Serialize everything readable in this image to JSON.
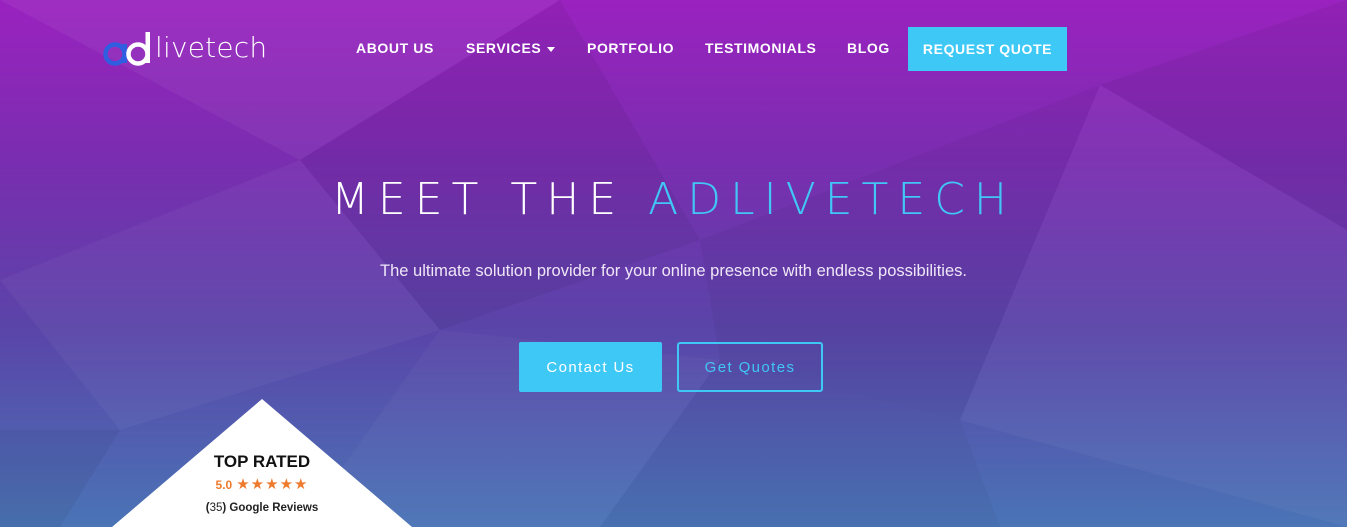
{
  "brand": {
    "logo_text": "livetech",
    "accent_color": "#3ec8f6",
    "logo_colors": [
      "#2f5fe0",
      "#3ec8f6"
    ]
  },
  "nav": {
    "items": [
      {
        "label": "ABOUT US"
      },
      {
        "label": "SERVICES"
      },
      {
        "label": "PORTFOLIO"
      },
      {
        "label": "TESTIMONIALS"
      },
      {
        "label": "BLOG"
      }
    ],
    "cta_label": "REQUEST QUOTE"
  },
  "hero": {
    "title_prefix": "MEET THE ",
    "title_accent": "ADLIVETECH",
    "subtitle": "The ultimate solution provider for your online presence with endless possibilities.",
    "primary_button": "Contact Us",
    "secondary_button": "Get Quotes"
  },
  "badge": {
    "title": "TOP RATED",
    "score": "5.0",
    "stars": 5,
    "review_count": "35",
    "review_label": "Google Reviews",
    "star_color": "#ee7a2e"
  }
}
